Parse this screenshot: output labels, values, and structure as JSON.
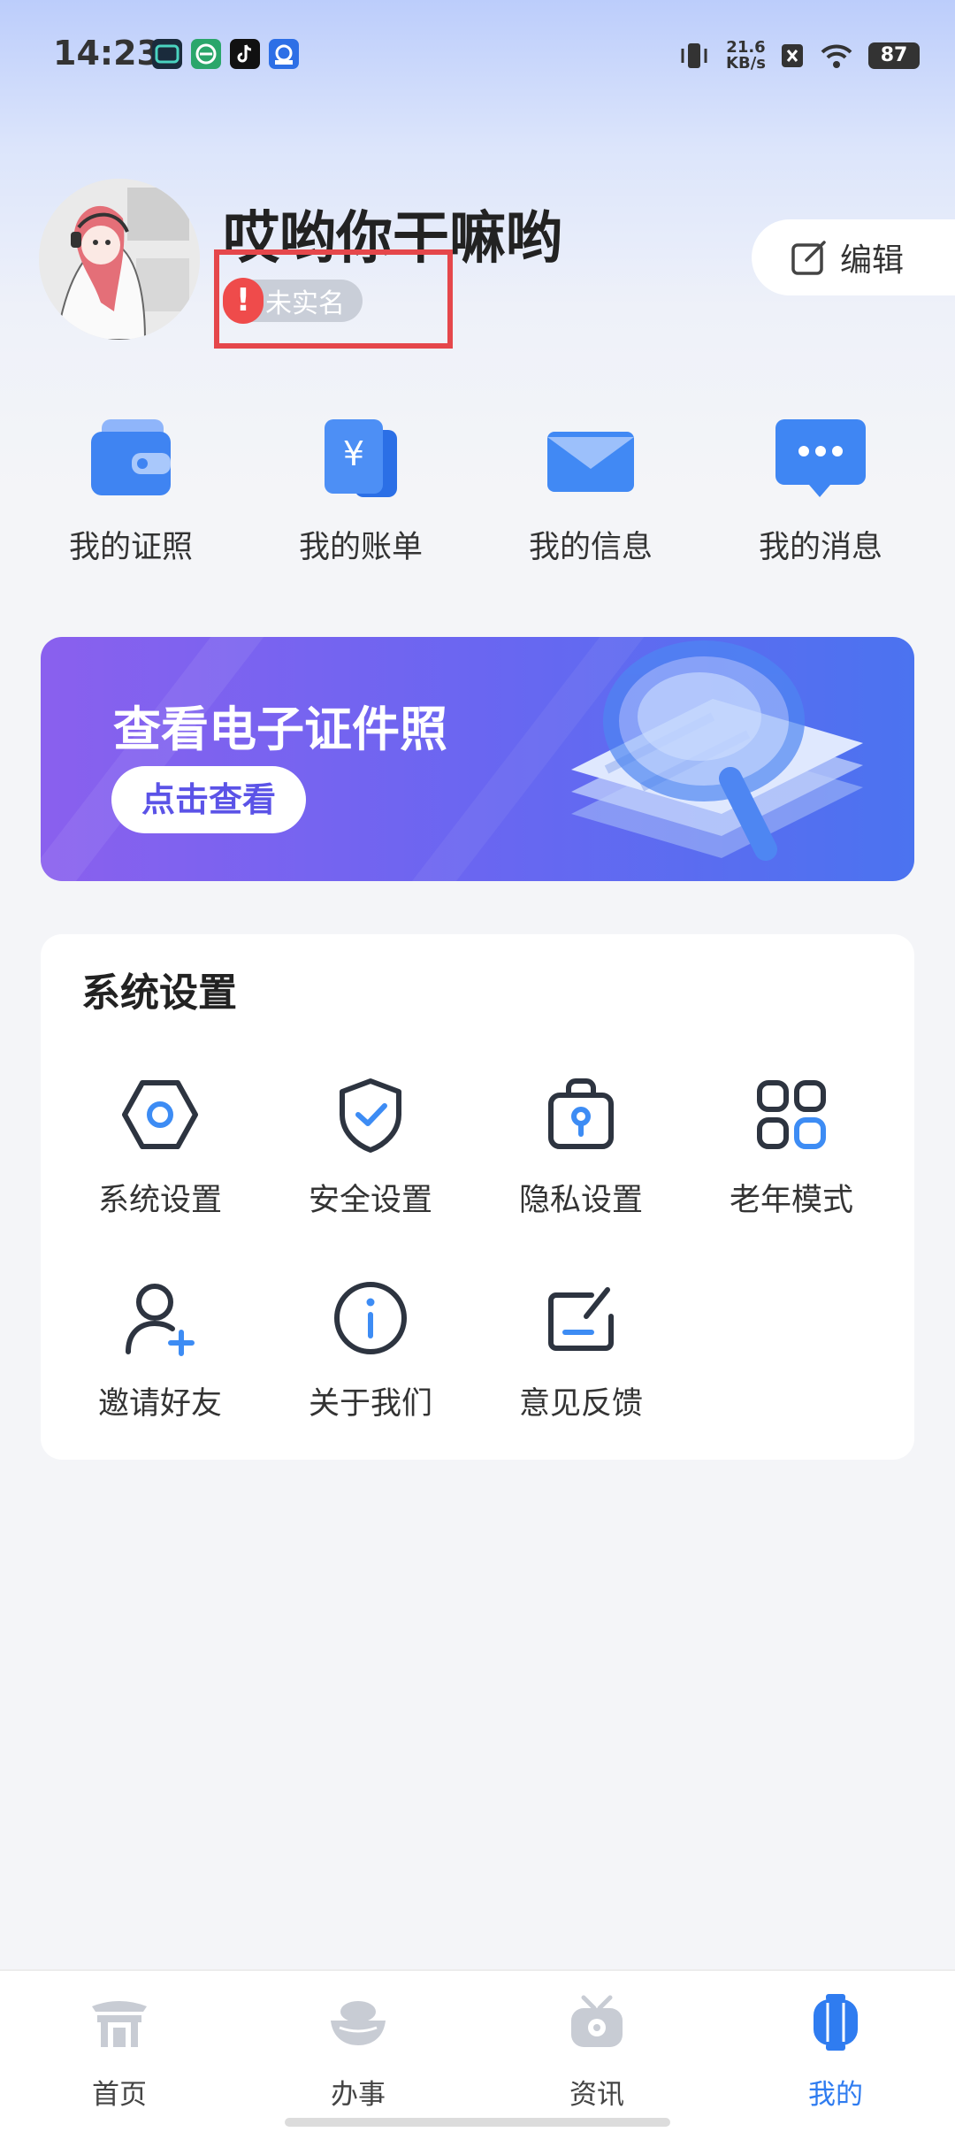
{
  "status_bar": {
    "time": "14:23",
    "app_icons": [
      "cc-app-icon",
      "green-app-icon",
      "tiktok-icon",
      "cloud-app-icon"
    ],
    "net_speed_value": "21.6",
    "net_speed_unit": "KB/s",
    "battery": "87"
  },
  "profile": {
    "name": "哎哟你干嘛哟",
    "verify_status": "未实名",
    "edit_label": "编辑"
  },
  "quick_links": [
    {
      "label": "我的证照",
      "icon": "wallet-icon"
    },
    {
      "label": "我的账单",
      "icon": "bill-icon"
    },
    {
      "label": "我的信息",
      "icon": "mail-icon"
    },
    {
      "label": "我的消息",
      "icon": "chat-bubble-icon"
    }
  ],
  "banner": {
    "title": "查看电子证件照",
    "button_label": "点击查看"
  },
  "settings": {
    "title": "系统设置",
    "items": [
      {
        "label": "系统设置",
        "icon": "hexagon-settings-icon"
      },
      {
        "label": "安全设置",
        "icon": "shield-check-icon"
      },
      {
        "label": "隐私设置",
        "icon": "lock-bag-icon"
      },
      {
        "label": "老年模式",
        "icon": "grid-icon"
      },
      {
        "label": "邀请好友",
        "icon": "add-user-icon"
      },
      {
        "label": "关于我们",
        "icon": "info-icon"
      },
      {
        "label": "意见反馈",
        "icon": "feedback-edit-icon"
      }
    ]
  },
  "bottom_nav": {
    "items": [
      {
        "label": "首页",
        "icon": "home-gate-icon"
      },
      {
        "label": "办事",
        "icon": "bowl-icon"
      },
      {
        "label": "资讯",
        "icon": "tv-icon"
      },
      {
        "label": "我的",
        "icon": "lantern-icon"
      }
    ],
    "active_index": 3
  },
  "colors": {
    "accent_blue": "#2f7cf0",
    "warning_red": "#ef4b4b",
    "highlight_red": "#e5474b",
    "banner_start": "#8a60ee",
    "banner_end": "#4b73f0"
  }
}
